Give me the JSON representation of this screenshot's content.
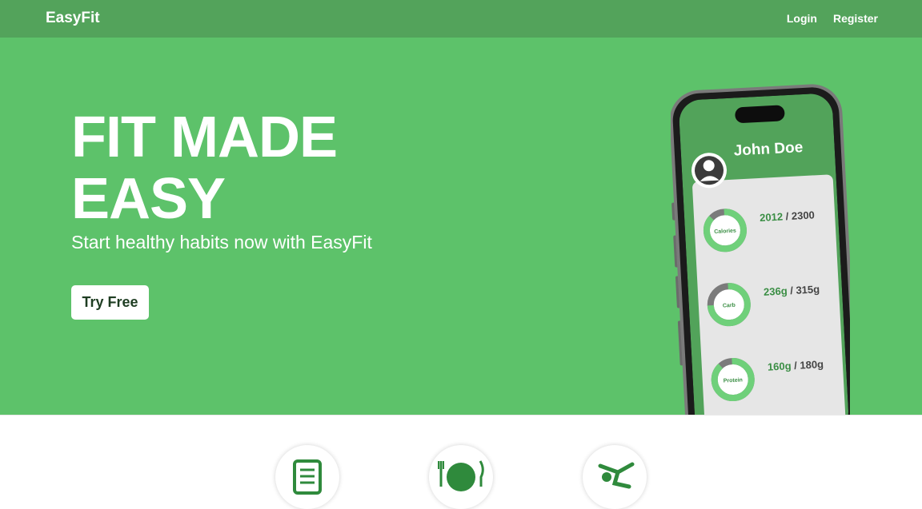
{
  "navbar": {
    "brand": "EasyFit",
    "links": [
      {
        "label": "Login"
      },
      {
        "label": "Register"
      }
    ]
  },
  "hero": {
    "headline_line1": "FIT MADE",
    "headline_line2": "EASY",
    "subheadline": "Start healthy habits now with EasyFit",
    "cta_label": "Try Free"
  },
  "phone": {
    "user_name": "John Doe",
    "stats": [
      {
        "label": "Calories",
        "current": "2012",
        "target": "2300",
        "fraction": 0.875
      },
      {
        "label": "Carb",
        "current": "236g",
        "target": "315g",
        "fraction": 0.75
      },
      {
        "label": "Protein",
        "current": "160g",
        "target": "180g",
        "fraction": 0.89
      }
    ]
  },
  "features": {
    "icons": [
      "document-icon",
      "plate-cutlery-icon",
      "exercise-icon"
    ]
  },
  "colors": {
    "nav_green": "#53a35b",
    "hero_green": "#5dc26a",
    "dark_green_text": "#3a8e44"
  }
}
